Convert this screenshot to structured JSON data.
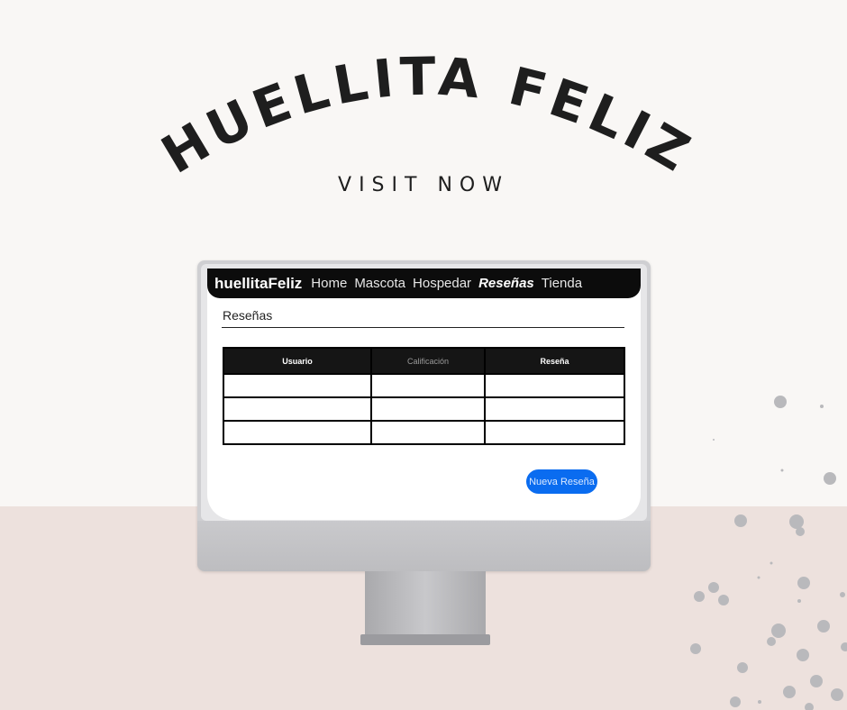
{
  "poster": {
    "title": "HUELLITA FELIZ",
    "subtitle": "VISIT NOW"
  },
  "app": {
    "brand": "huellitaFeliz",
    "nav": [
      {
        "label": "Home",
        "active": false
      },
      {
        "label": "Mascota",
        "active": false
      },
      {
        "label": "Hospedar",
        "active": false
      },
      {
        "label": "Reseñas",
        "active": true
      },
      {
        "label": "Tienda",
        "active": false
      }
    ],
    "section_title": "Reseñas",
    "table": {
      "headers": [
        "Usuario",
        "Calificación",
        "Reseña"
      ],
      "rows": [
        [
          "",
          "",
          ""
        ],
        [
          "",
          "",
          ""
        ],
        [
          "",
          "",
          ""
        ]
      ]
    },
    "new_review_button": "Nueva Reseña"
  },
  "colors": {
    "navbar": "#0c0c0c",
    "button": "#0a6cf0",
    "wall": "#f9f7f5",
    "floor": "#ede1dd"
  }
}
